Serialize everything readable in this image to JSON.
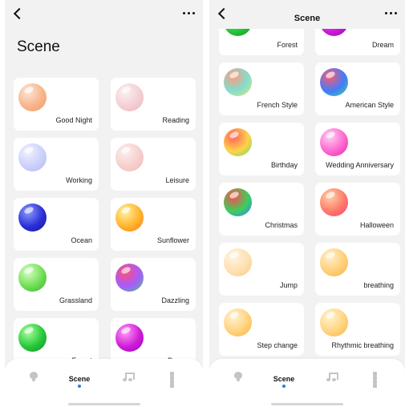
{
  "left_screen": {
    "title": "Scene",
    "scenes": [
      {
        "label": "Good Night",
        "colors": [
          "#fbe6d8",
          "#f7b48a",
          "#f19a6e"
        ]
      },
      {
        "label": "Reading",
        "colors": [
          "#fbf0f0",
          "#f3cfd3",
          "#eab7bd"
        ]
      },
      {
        "label": "Working",
        "colors": [
          "#f1f1ff",
          "#cbd0fb",
          "#b4b8f2"
        ]
      },
      {
        "label": "Leisure",
        "colors": [
          "#fbeeee",
          "#f6cfcc",
          "#efbdb8"
        ]
      },
      {
        "label": "Ocean",
        "colors": [
          "#8b9cff",
          "#2b2fd6",
          "#141a8f"
        ]
      },
      {
        "label": "Sunflower",
        "colors": [
          "#fff1a3",
          "#ffb42b",
          "#ff7a16"
        ]
      },
      {
        "label": "Grassland",
        "colors": [
          "#d6ffc4",
          "#6fde54",
          "#37b22c"
        ]
      },
      {
        "label": "Dazzling",
        "colors": [
          "#ff4f7a",
          "#a55cff",
          "#3fd36a"
        ]
      },
      {
        "label": "Forest",
        "colors": [
          "#a8ff9c",
          "#27c83b",
          "#0f8f22"
        ]
      },
      {
        "label": "Dream",
        "colors": [
          "#ff9cf5",
          "#d11bd8",
          "#8c0cb2"
        ]
      }
    ]
  },
  "right_screen": {
    "title": "Scene",
    "scenes": [
      {
        "label": "Forest",
        "colors": [
          "#a8ff9c",
          "#27c83b",
          "#0f8f22"
        ]
      },
      {
        "label": "Dream",
        "colors": [
          "#ff9cf5",
          "#d11bd8",
          "#8c0cb2"
        ]
      },
      {
        "label": "French Style",
        "colors": [
          "#ff9a7a",
          "#7fdfd2",
          "#f7e15c"
        ]
      },
      {
        "label": "American Style",
        "colors": [
          "#ff5a6e",
          "#3f7dfd",
          "#45d98a"
        ]
      },
      {
        "label": "Birthday",
        "colors": [
          "#ff5f5f",
          "#ffd34a",
          "#5fdc5f"
        ]
      },
      {
        "label": "Wedding Anniversary",
        "colors": [
          "#ffd0f2",
          "#ff66cf",
          "#e02aa9"
        ]
      },
      {
        "label": "Christmas",
        "colors": [
          "#ff4b4b",
          "#3ad05f",
          "#3b78ff"
        ]
      },
      {
        "label": "Halloween",
        "colors": [
          "#ffd1a6",
          "#ff7a6a",
          "#ff3c7a"
        ]
      },
      {
        "label": "Jump",
        "colors": [
          "#fff4e6",
          "#ffe0b0",
          "#f6c88a"
        ]
      },
      {
        "label": "breathing",
        "colors": [
          "#fff0cc",
          "#ffcf78",
          "#f7b24a"
        ]
      },
      {
        "label": "Step change",
        "colors": [
          "#fff3d6",
          "#ffd27c",
          "#f5b545"
        ]
      },
      {
        "label": "Rhythmic breathing",
        "colors": [
          "#fff2d0",
          "#ffd580",
          "#f2b241"
        ]
      }
    ]
  },
  "tabbar": {
    "active_label": "Scene",
    "tabs": [
      {
        "name": "bulb-icon"
      },
      {
        "label": "Scene",
        "active": true
      },
      {
        "name": "music-icon"
      },
      {
        "name": "apps-icon"
      }
    ],
    "accent_color": "#2a7de1"
  }
}
